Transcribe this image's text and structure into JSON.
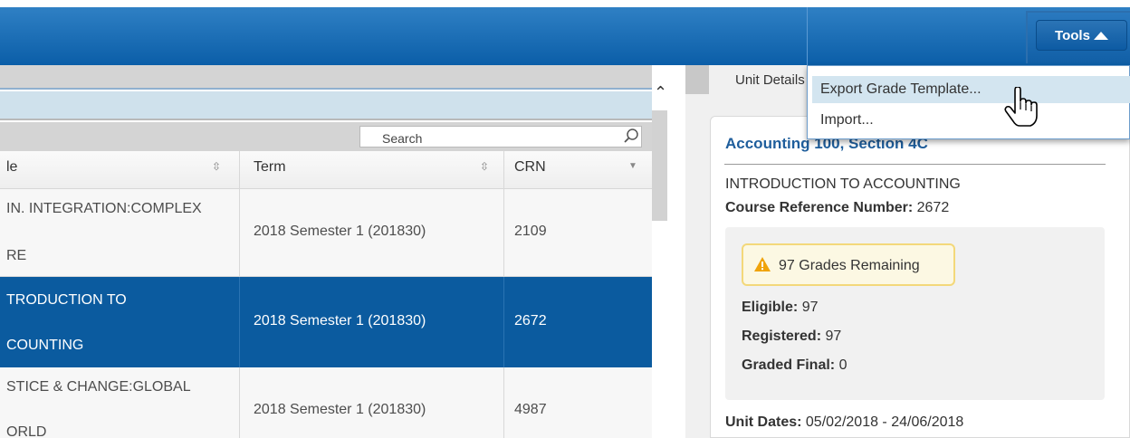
{
  "header": {
    "tools_label": "Tools"
  },
  "search": {
    "placeholder": "Search"
  },
  "table": {
    "columns": [
      {
        "label": "le"
      },
      {
        "label": "Term"
      },
      {
        "label": "CRN"
      }
    ],
    "rows": [
      {
        "title_line1": "IN. INTEGRATION:COMPLEX",
        "title_line2": "RE",
        "term": "2018 Semester 1 (201830)",
        "crn": "2109",
        "selected": false
      },
      {
        "title_line1": "TRODUCTION TO",
        "title_line2": "COUNTING",
        "term": "2018 Semester 1 (201830)",
        "crn": "2672",
        "selected": true
      },
      {
        "title_line1": "STICE & CHANGE:GLOBAL",
        "title_line2": "ORLD",
        "term": "2018 Semester 1 (201830)",
        "crn": "4987",
        "selected": false
      }
    ]
  },
  "details": {
    "tab_label": "Unit Details",
    "heading": "Accounting 100, Section 4C",
    "course_title": "INTRODUCTION TO ACCOUNTING",
    "crn_label": "Course Reference Number:",
    "crn_value": "2672",
    "warning": "97 Grades Remaining",
    "eligible_label": "Eligible:",
    "eligible_value": "97",
    "registered_label": "Registered:",
    "registered_value": "97",
    "graded_label": "Graded Final:",
    "graded_value": "0",
    "dates_label": "Unit Dates:",
    "dates_value": "05/02/2018 - 24/06/2018"
  },
  "tools_menu": {
    "items": [
      {
        "label": "Export Grade Template..."
      },
      {
        "label": "Import..."
      }
    ]
  },
  "colors": {
    "header_blue": "#0b5ea8",
    "selected_row": "#0b5b9f",
    "heading_blue": "#1f5e9c",
    "warning_bg": "#fcf8e3",
    "warning_icon": "#f0a30a"
  }
}
